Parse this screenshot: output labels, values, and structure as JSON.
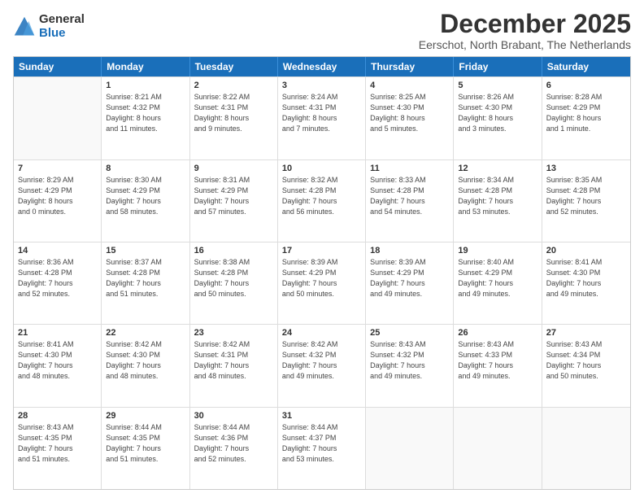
{
  "logo": {
    "general": "General",
    "blue": "Blue"
  },
  "title": "December 2025",
  "subtitle": "Eerschot, North Brabant, The Netherlands",
  "header": {
    "days": [
      "Sunday",
      "Monday",
      "Tuesday",
      "Wednesday",
      "Thursday",
      "Friday",
      "Saturday"
    ]
  },
  "weeks": [
    [
      {
        "day": "",
        "content": ""
      },
      {
        "day": "1",
        "content": "Sunrise: 8:21 AM\nSunset: 4:32 PM\nDaylight: 8 hours\nand 11 minutes."
      },
      {
        "day": "2",
        "content": "Sunrise: 8:22 AM\nSunset: 4:31 PM\nDaylight: 8 hours\nand 9 minutes."
      },
      {
        "day": "3",
        "content": "Sunrise: 8:24 AM\nSunset: 4:31 PM\nDaylight: 8 hours\nand 7 minutes."
      },
      {
        "day": "4",
        "content": "Sunrise: 8:25 AM\nSunset: 4:30 PM\nDaylight: 8 hours\nand 5 minutes."
      },
      {
        "day": "5",
        "content": "Sunrise: 8:26 AM\nSunset: 4:30 PM\nDaylight: 8 hours\nand 3 minutes."
      },
      {
        "day": "6",
        "content": "Sunrise: 8:28 AM\nSunset: 4:29 PM\nDaylight: 8 hours\nand 1 minute."
      }
    ],
    [
      {
        "day": "7",
        "content": "Sunrise: 8:29 AM\nSunset: 4:29 PM\nDaylight: 8 hours\nand 0 minutes."
      },
      {
        "day": "8",
        "content": "Sunrise: 8:30 AM\nSunset: 4:29 PM\nDaylight: 7 hours\nand 58 minutes."
      },
      {
        "day": "9",
        "content": "Sunrise: 8:31 AM\nSunset: 4:29 PM\nDaylight: 7 hours\nand 57 minutes."
      },
      {
        "day": "10",
        "content": "Sunrise: 8:32 AM\nSunset: 4:28 PM\nDaylight: 7 hours\nand 56 minutes."
      },
      {
        "day": "11",
        "content": "Sunrise: 8:33 AM\nSunset: 4:28 PM\nDaylight: 7 hours\nand 54 minutes."
      },
      {
        "day": "12",
        "content": "Sunrise: 8:34 AM\nSunset: 4:28 PM\nDaylight: 7 hours\nand 53 minutes."
      },
      {
        "day": "13",
        "content": "Sunrise: 8:35 AM\nSunset: 4:28 PM\nDaylight: 7 hours\nand 52 minutes."
      }
    ],
    [
      {
        "day": "14",
        "content": "Sunrise: 8:36 AM\nSunset: 4:28 PM\nDaylight: 7 hours\nand 52 minutes."
      },
      {
        "day": "15",
        "content": "Sunrise: 8:37 AM\nSunset: 4:28 PM\nDaylight: 7 hours\nand 51 minutes."
      },
      {
        "day": "16",
        "content": "Sunrise: 8:38 AM\nSunset: 4:28 PM\nDaylight: 7 hours\nand 50 minutes."
      },
      {
        "day": "17",
        "content": "Sunrise: 8:39 AM\nSunset: 4:29 PM\nDaylight: 7 hours\nand 50 minutes."
      },
      {
        "day": "18",
        "content": "Sunrise: 8:39 AM\nSunset: 4:29 PM\nDaylight: 7 hours\nand 49 minutes."
      },
      {
        "day": "19",
        "content": "Sunrise: 8:40 AM\nSunset: 4:29 PM\nDaylight: 7 hours\nand 49 minutes."
      },
      {
        "day": "20",
        "content": "Sunrise: 8:41 AM\nSunset: 4:30 PM\nDaylight: 7 hours\nand 49 minutes."
      }
    ],
    [
      {
        "day": "21",
        "content": "Sunrise: 8:41 AM\nSunset: 4:30 PM\nDaylight: 7 hours\nand 48 minutes."
      },
      {
        "day": "22",
        "content": "Sunrise: 8:42 AM\nSunset: 4:30 PM\nDaylight: 7 hours\nand 48 minutes."
      },
      {
        "day": "23",
        "content": "Sunrise: 8:42 AM\nSunset: 4:31 PM\nDaylight: 7 hours\nand 48 minutes."
      },
      {
        "day": "24",
        "content": "Sunrise: 8:42 AM\nSunset: 4:32 PM\nDaylight: 7 hours\nand 49 minutes."
      },
      {
        "day": "25",
        "content": "Sunrise: 8:43 AM\nSunset: 4:32 PM\nDaylight: 7 hours\nand 49 minutes."
      },
      {
        "day": "26",
        "content": "Sunrise: 8:43 AM\nSunset: 4:33 PM\nDaylight: 7 hours\nand 49 minutes."
      },
      {
        "day": "27",
        "content": "Sunrise: 8:43 AM\nSunset: 4:34 PM\nDaylight: 7 hours\nand 50 minutes."
      }
    ],
    [
      {
        "day": "28",
        "content": "Sunrise: 8:43 AM\nSunset: 4:35 PM\nDaylight: 7 hours\nand 51 minutes."
      },
      {
        "day": "29",
        "content": "Sunrise: 8:44 AM\nSunset: 4:35 PM\nDaylight: 7 hours\nand 51 minutes."
      },
      {
        "day": "30",
        "content": "Sunrise: 8:44 AM\nSunset: 4:36 PM\nDaylight: 7 hours\nand 52 minutes."
      },
      {
        "day": "31",
        "content": "Sunrise: 8:44 AM\nSunset: 4:37 PM\nDaylight: 7 hours\nand 53 minutes."
      },
      {
        "day": "",
        "content": ""
      },
      {
        "day": "",
        "content": ""
      },
      {
        "day": "",
        "content": ""
      }
    ]
  ]
}
